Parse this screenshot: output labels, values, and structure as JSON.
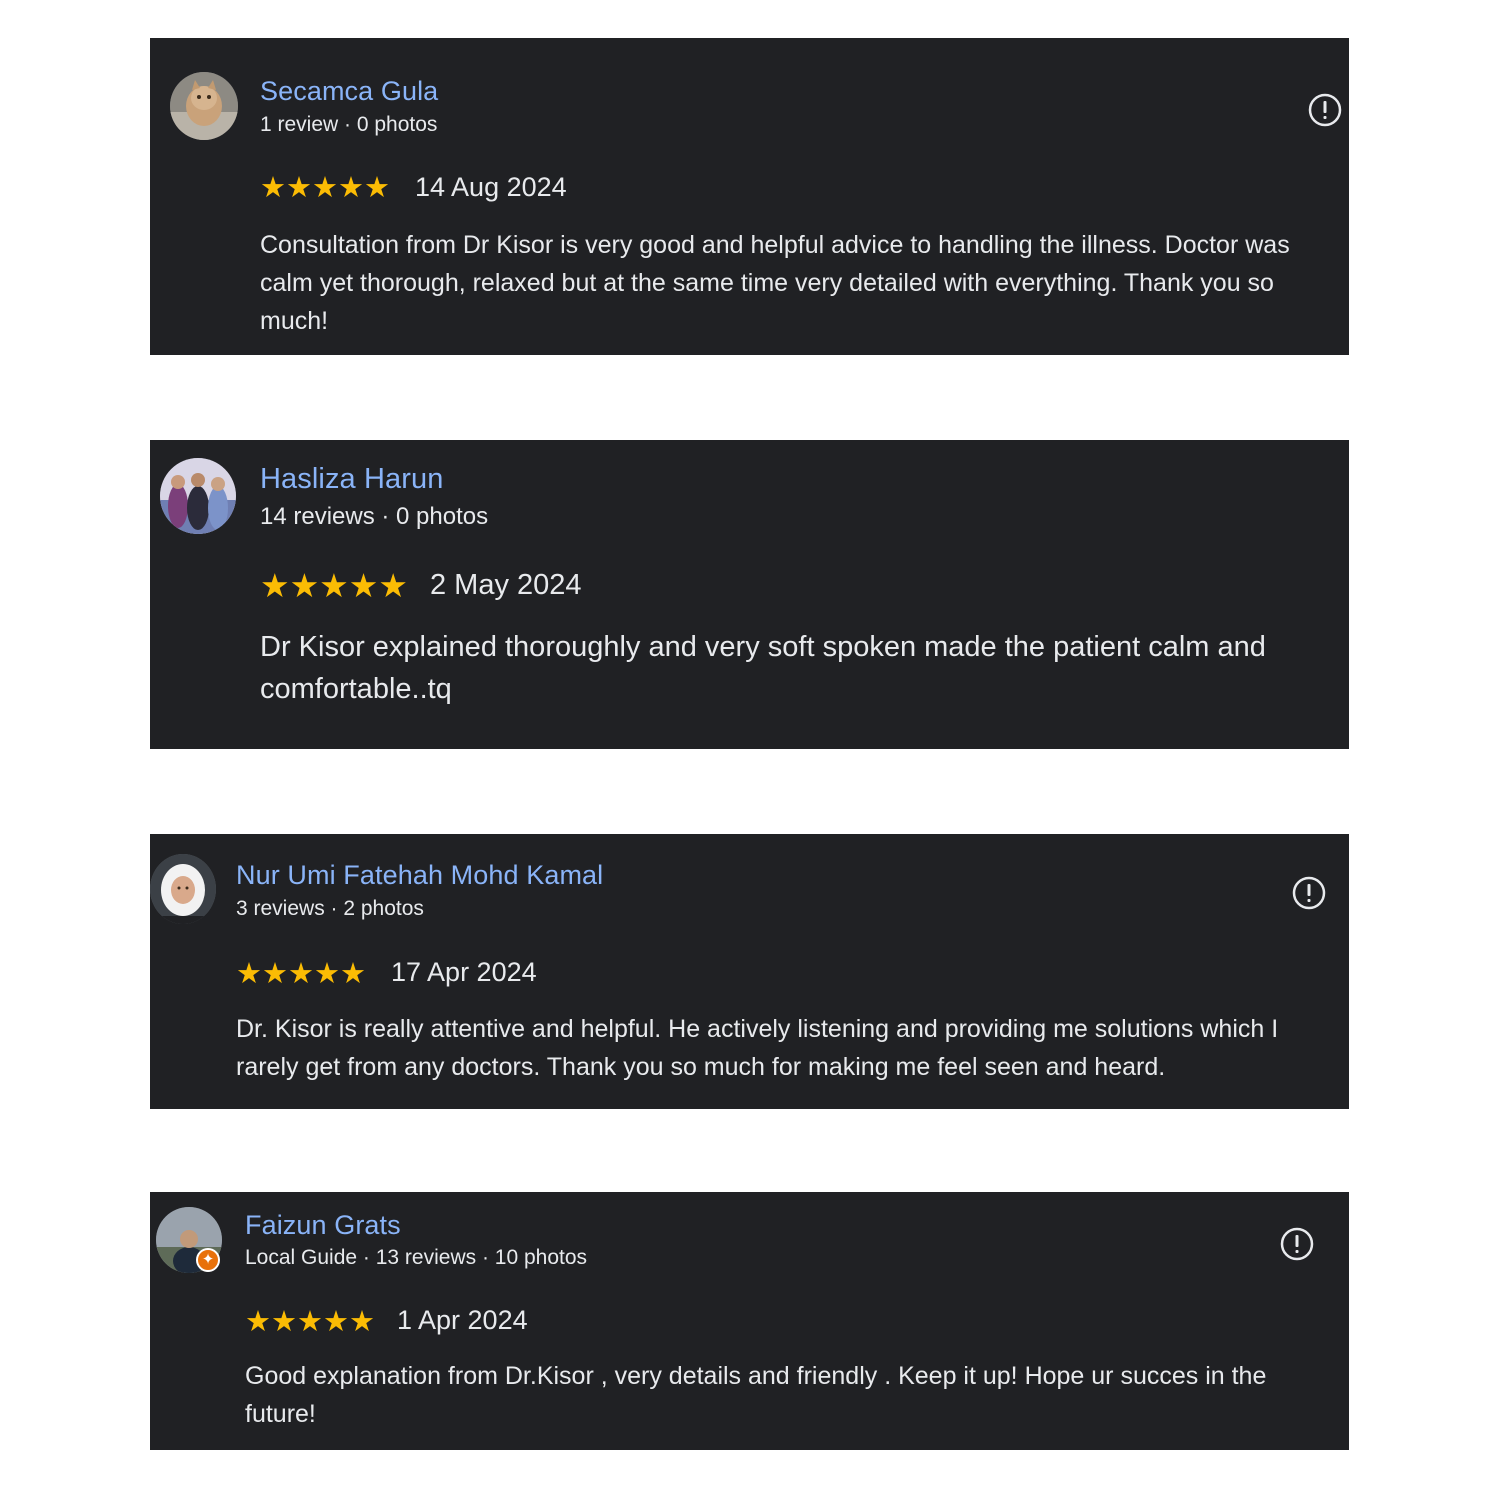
{
  "reviews": [
    {
      "name": "Secamca Gula",
      "meta": "1 review · 0 photos",
      "stars": "★★★★★",
      "rating": 5,
      "date": "14 Aug 2024",
      "text": "Consultation from Dr Kisor is very good and helpful advice to handling the illness. Doctor was calm yet thorough, relaxed but at the same time very detailed with everything. Thank you so much!",
      "avatar_icon": "cat-photo-avatar"
    },
    {
      "name": "Hasliza Harun",
      "meta": "14 reviews · 0 photos",
      "stars": "★★★★★",
      "rating": 5,
      "date": "2 May 2024",
      "text": "Dr Kisor explained thoroughly and very soft spoken made the patient calm and comfortable..tq",
      "avatar_icon": "group-photo-avatar"
    },
    {
      "name": "Nur Umi Fatehah Mohd Kamal",
      "meta": "3 reviews · 2 photos",
      "stars": "★★★★★",
      "rating": 5,
      "date": "17 Apr 2024",
      "text": "Dr. Kisor is really attentive and helpful. He actively listening and providing me solutions which I rarely get from any doctors. Thank you so much for making me feel seen and heard.",
      "avatar_icon": "person-photo-avatar"
    },
    {
      "name": "Faizun Grats",
      "meta": "Local Guide · 13 reviews · 10 photos",
      "stars": "★★★★★",
      "rating": 5,
      "date": "1 Apr 2024",
      "text": "Good explanation from Dr.Kisor , very details and friendly . Keep it up! Hope ur succes in the future!",
      "avatar_icon": "person-photo-avatar",
      "badge_icon": "local-guide-badge-icon"
    }
  ],
  "colors": {
    "card_bg": "#202124",
    "name": "#8ab4f8",
    "text": "#e8eaed",
    "star": "#fbbc04",
    "local_guide_badge": "#e8710a"
  },
  "flag_icon": "report-flag-icon"
}
